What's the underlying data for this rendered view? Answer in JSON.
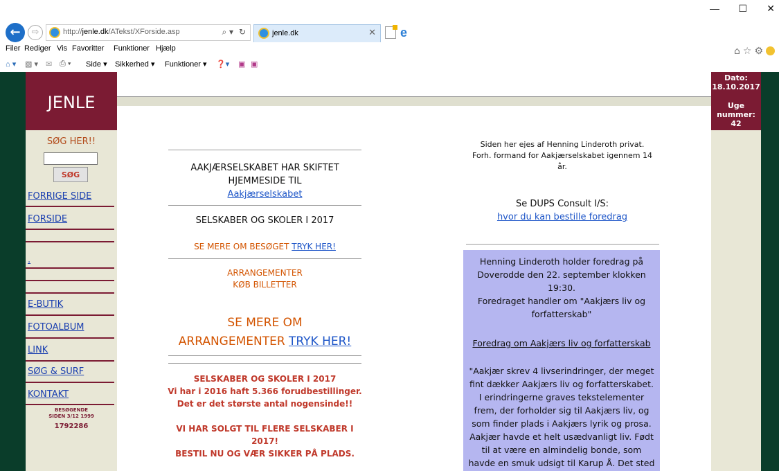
{
  "browser": {
    "url_prefix": "http://",
    "url_domain": "jenle.dk",
    "url_path": "/ATekst/XForside.asp",
    "tab_title": "jenle.dk",
    "menu": [
      "Filer",
      "Rediger",
      "Vis",
      "Favoritter",
      "Funktioner",
      "Hjælp"
    ],
    "command_bar": [
      "Side ▾",
      "Sikkerhed ▾",
      "Funktioner ▾"
    ],
    "icons": [
      "back-icon",
      "forward-icon",
      "search-icon",
      "refresh-icon",
      "home-icon",
      "star-icon",
      "gear-icon",
      "smiley-icon"
    ]
  },
  "sidebar": {
    "logo": "JENLE",
    "search_title": "SØG HER!!",
    "search_button": "SØG",
    "links": {
      "forrige": "FORRIGE SIDE",
      "forside": "FORSIDE",
      "dot": ".",
      "ebutik": "E-BUTIK",
      "fotoalbum": "FOTOALBUM",
      "link": "LINK",
      "sog_surf": "SØG & SURF",
      "kontakt": "KONTAKT"
    },
    "visitors_label_1": "BESØGENDE",
    "visitors_label_2": "SIDEN 3/12 1999",
    "visitors_count": "1792286"
  },
  "date_panel": {
    "date_label": "Dato:",
    "date_value": "18.10.2017",
    "week_label_1": "Uge",
    "week_label_2": "nummer:",
    "week_value": "42"
  },
  "center": {
    "moved_1": "AAKJÆRSELSKABET HAR SKIFTET",
    "moved_2": "HJEMMESIDE TIL",
    "moved_link": "Aakjærselskabet",
    "groups_title": "SELSKABER OG SKOLER I 2017",
    "visit_text": "SE MERE OM BESØGET ",
    "visit_link": "TRYK HER!",
    "events_1": "ARRANGEMENTER",
    "events_2": "KØB BILLETTER",
    "more_1": "SE MERE OM",
    "more_2": "ARRANGEMENTER ",
    "more_link": "TRYK HER!",
    "red_title": "SELSKABER OG SKOLER I 2017",
    "red_line_1": "Vi har i 2016 haft 5.366 forudbestillinger.",
    "red_line_2": "Det er det største antal nogensinde!!",
    "red_line_3": "VI HAR SOLGT TIL FLERE SELSKABER I",
    "red_line_4": "2017!",
    "red_line_5": "BESTIL NU OG VÆR SIKKER PÅ PLADS."
  },
  "right": {
    "owner_1": "Siden her ejes af Henning Linderoth privat.",
    "owner_2": "Forh. formand for Aakjærselskabet igennem 14",
    "owner_3": "år.",
    "dups_title": "Se DUPS Consult I/S:",
    "dups_link": "hvor du kan bestille foredrag",
    "notice_lines": [
      "Henning Linderoth holder foredrag på",
      "Doverodde den 22. september klokken",
      "19:30.",
      "Foredraget handler om \"Aakjærs liv og",
      "forfatterskab\""
    ],
    "notice_link": "Foredrag om Aakjærs liv og forfatterskab",
    "quote_lines": [
      "\"Aakjær skrev 4 livserindringer, der meget",
      "fint dækker Aakjærs liv og forfatterskabet.",
      "I erindringerne graves tekstelementer",
      "frem, der forholder sig til Aakjærs liv, og",
      "som finder plads i Aakjærs lyrik og prosa.",
      "Aakjær havde et helt usædvanligt liv. Født",
      "til at være en almindelig bonde, som",
      "havde en smuk udsigt til Karup Å. Det sted"
    ]
  }
}
